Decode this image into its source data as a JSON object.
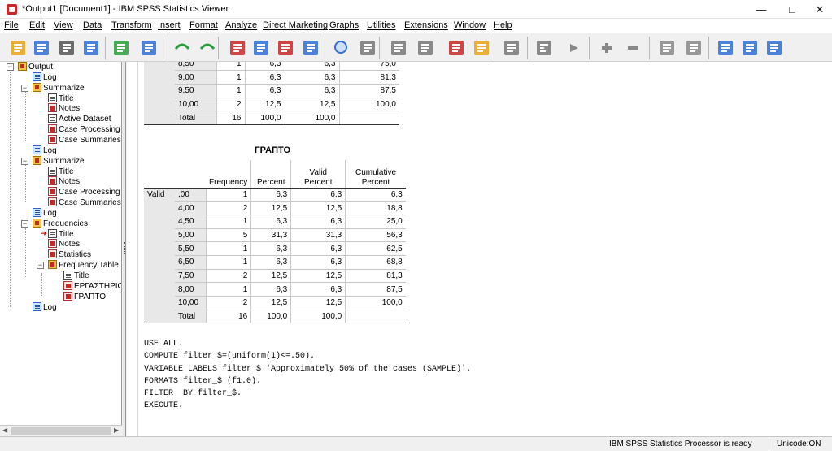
{
  "window": {
    "title": "*Output1 [Document1] - IBM SPSS Statistics Viewer",
    "minimize": "—",
    "maximize": "□",
    "close": "✕"
  },
  "menu": [
    "File",
    "Edit",
    "View",
    "Data",
    "Transform",
    "Insert",
    "Format",
    "Analyze",
    "Direct Marketing",
    "Graphs",
    "Utilities",
    "Extensions",
    "Window",
    "Help"
  ],
  "toolbar_icons": [
    "open-icon",
    "save-icon",
    "print-icon",
    "print-preview-icon",
    "export-icon",
    "recall-dialog-icon",
    "undo-icon",
    "redo-icon",
    "goto-case-icon",
    "goto-variable-icon",
    "variables-icon",
    "insert-table-icon",
    "zoom-icon",
    "select-cases-icon",
    "split-file-icon",
    "weight-cases-icon",
    "value-labels-icon",
    "text-icon",
    "script-icon",
    "designate-window-icon",
    "back-icon",
    "forward-icon",
    "expand-icon",
    "collapse-icon",
    "show-icon",
    "hide-icon",
    "insert-heading-icon",
    "insert-title-icon",
    "insert-text-icon"
  ],
  "tree": [
    {
      "label": "Output",
      "icon": "book",
      "level": 0
    },
    {
      "label": "Log",
      "icon": "log",
      "level": 1
    },
    {
      "label": "Summarize",
      "icon": "book",
      "level": 1
    },
    {
      "label": "Title",
      "icon": "page",
      "level": 2
    },
    {
      "label": "Notes",
      "icon": "tab",
      "level": 2
    },
    {
      "label": "Active Dataset",
      "icon": "page",
      "level": 2
    },
    {
      "label": "Case Processing",
      "icon": "tab",
      "level": 2
    },
    {
      "label": "Case Summaries",
      "icon": "tab",
      "level": 2
    },
    {
      "label": "Log",
      "icon": "log",
      "level": 1
    },
    {
      "label": "Summarize",
      "icon": "book",
      "level": 1
    },
    {
      "label": "Title",
      "icon": "page",
      "level": 2
    },
    {
      "label": "Notes",
      "icon": "tab",
      "level": 2
    },
    {
      "label": "Case Processing",
      "icon": "tab",
      "level": 2
    },
    {
      "label": "Case Summaries",
      "icon": "tab",
      "level": 2
    },
    {
      "label": "Log",
      "icon": "log",
      "level": 1
    },
    {
      "label": "Frequencies",
      "icon": "book",
      "level": 1
    },
    {
      "label": "Title",
      "icon": "page",
      "level": 2
    },
    {
      "label": "Notes",
      "icon": "tab",
      "level": 2
    },
    {
      "label": "Statistics",
      "icon": "tab",
      "level": 2
    },
    {
      "label": "Frequency Table",
      "icon": "book",
      "level": 2
    },
    {
      "label": "Title",
      "icon": "page",
      "level": 3
    },
    {
      "label": "ΕΡΓΑΣΤΗΡΙΟ",
      "icon": "tab",
      "level": 3
    },
    {
      "label": "ΓΡΑΠΤΟ",
      "icon": "tab",
      "level": 3
    },
    {
      "label": "Log",
      "icon": "log",
      "level": 1
    }
  ],
  "top_table": {
    "rows": [
      [
        "8,50",
        "1",
        "6,3",
        "6,3",
        "75,0"
      ],
      [
        "9,00",
        "1",
        "6,3",
        "6,3",
        "81,3"
      ],
      [
        "9,50",
        "1",
        "6,3",
        "6,3",
        "87,5"
      ],
      [
        "10,00",
        "2",
        "12,5",
        "12,5",
        "100,0"
      ]
    ],
    "total": [
      "Total",
      "16",
      "100,0",
      "100,0",
      ""
    ]
  },
  "grapto_table": {
    "title": "ΓΡΑΠΤΟ",
    "headers": [
      "Frequency",
      "Percent",
      "Valid Percent",
      "Cumulative Percent"
    ],
    "valid_label": "Valid",
    "rows": [
      [
        ",00",
        "1",
        "6,3",
        "6,3",
        "6,3"
      ],
      [
        "4,00",
        "2",
        "12,5",
        "12,5",
        "18,8"
      ],
      [
        "4,50",
        "1",
        "6,3",
        "6,3",
        "25,0"
      ],
      [
        "5,00",
        "5",
        "31,3",
        "31,3",
        "56,3"
      ],
      [
        "5,50",
        "1",
        "6,3",
        "6,3",
        "62,5"
      ],
      [
        "6,50",
        "1",
        "6,3",
        "6,3",
        "68,8"
      ],
      [
        "7,50",
        "2",
        "12,5",
        "12,5",
        "81,3"
      ],
      [
        "8,00",
        "1",
        "6,3",
        "6,3",
        "87,5"
      ],
      [
        "10,00",
        "2",
        "12,5",
        "12,5",
        "100,0"
      ]
    ],
    "total": [
      "Total",
      "16",
      "100,0",
      "100,0",
      ""
    ]
  },
  "syntax": [
    "USE ALL.",
    "COMPUTE filter_$=(uniform(1)<=.50).",
    "VARIABLE LABELS filter_$ 'Approximately 50% of the cases (SAMPLE)'.",
    "FORMATS filter_$ (f1.0).",
    "FILTER  BY filter_$.",
    "EXECUTE."
  ],
  "status": {
    "processor": "IBM SPSS Statistics Processor is ready",
    "unicode": "Unicode:ON"
  },
  "colors": {
    "accent": "#c62828",
    "row_label_bg": "#e8e8e8",
    "toolbar_blue": "#2f6fd6"
  }
}
